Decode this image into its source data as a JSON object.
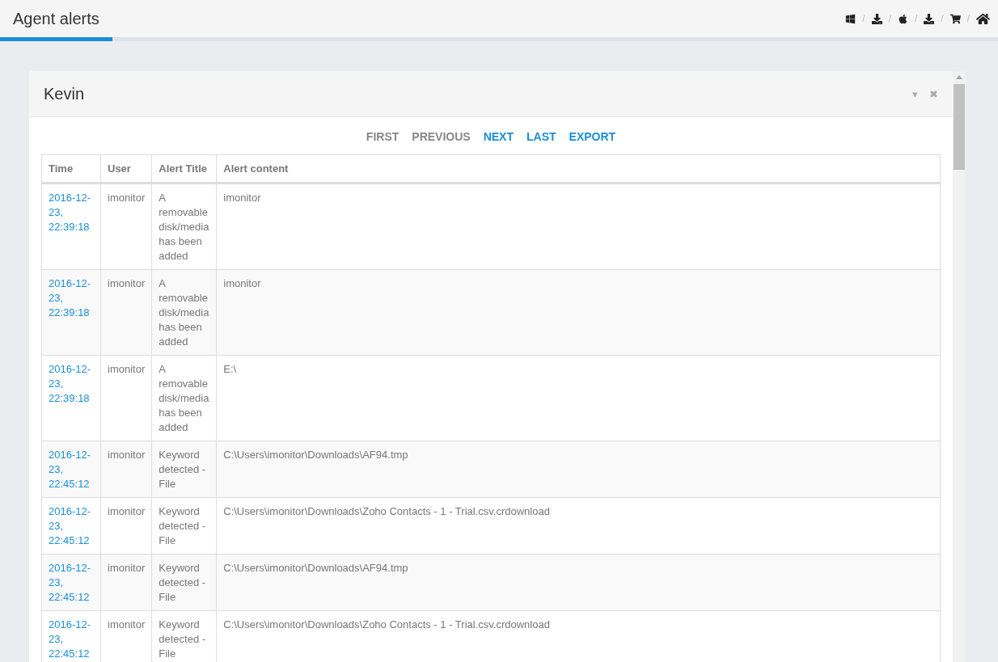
{
  "page_tab": {
    "label": "Agent alerts",
    "selected": true
  },
  "nav_links": [
    {
      "kind": "windows",
      "separator": "/"
    },
    {
      "kind": "download",
      "separator": "/"
    },
    {
      "kind": "apple",
      "separator": "/"
    },
    {
      "kind": "download",
      "separator": "/"
    },
    {
      "kind": "cart",
      "separator": "/"
    },
    {
      "kind": "home"
    }
  ],
  "panel": {
    "title": "Kevin",
    "collapse_icon": "▾",
    "close_icon": "✖"
  },
  "pagination": [
    {
      "label": "FIRST",
      "disabled": true
    },
    {
      "label": "PREVIOUS",
      "disabled": true
    },
    {
      "label": "NEXT",
      "disabled": false
    },
    {
      "label": "LAST",
      "disabled": false
    },
    {
      "label": "EXPORT",
      "disabled": false
    }
  ],
  "table": {
    "columns": [
      "Time",
      "User",
      "Alert Title",
      "Alert content"
    ],
    "rows": [
      {
        "time": "2016-12-23, 22:39:18",
        "user": "imonitor",
        "title": "A removable disk/media has been added",
        "content": "imonitor"
      },
      {
        "time": "2016-12-23, 22:39:18",
        "user": "imonitor",
        "title": "A removable disk/media has been added",
        "content": "imonitor"
      },
      {
        "time": "2016-12-23, 22:39:18",
        "user": "imonitor",
        "title": "A removable disk/media has been added",
        "content": "E:\\"
      },
      {
        "time": "2016-12-23, 22:45:12",
        "user": "imonitor",
        "title": "Keyword detected - File",
        "content": "C:\\Users\\imonitor\\Downloads\\AF94.tmp"
      },
      {
        "time": "2016-12-23, 22:45:12",
        "user": "imonitor",
        "title": "Keyword detected - File",
        "content": "C:\\Users\\imonitor\\Downloads\\Zoho Contacts - 1 - Trial.csv.crdownload"
      },
      {
        "time": "2016-12-23, 22:45:12",
        "user": "imonitor",
        "title": "Keyword detected - File",
        "content": "C:\\Users\\imonitor\\Downloads\\AF94.tmp"
      },
      {
        "time": "2016-12-23, 22:45:12",
        "user": "imonitor",
        "title": "Keyword detected - File",
        "content": "C:\\Users\\imonitor\\Downloads\\Zoho Contacts - 1 - Trial.csv.crdownload"
      }
    ]
  }
}
